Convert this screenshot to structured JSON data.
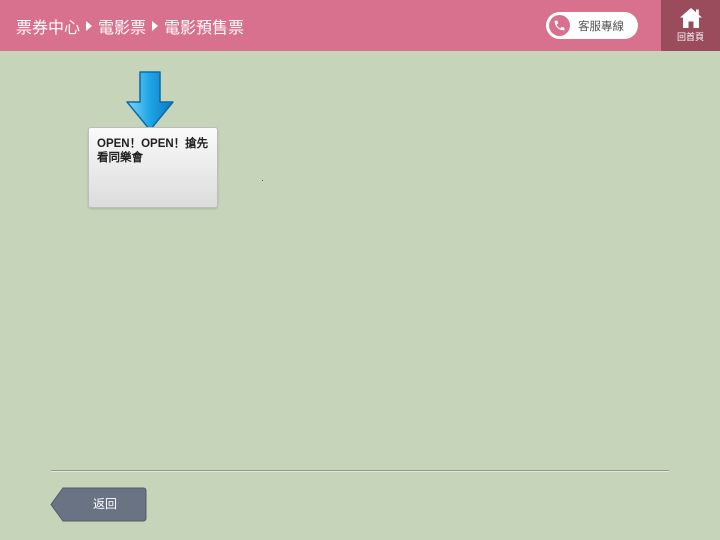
{
  "header": {
    "breadcrumb": [
      "票券中心",
      "電影票",
      "電影預售票"
    ],
    "service_label": "客服專線",
    "home_label": "回首頁"
  },
  "icons": {
    "phone": "phone-icon",
    "home": "home-icon",
    "pointer": "down-arrow-icon"
  },
  "cards": [
    {
      "title": "OPEN！OPEN！搶先看同樂會"
    }
  ],
  "footer": {
    "back_label": "返回"
  },
  "colors": {
    "header": "#d8718d",
    "home": "#9a4c5c",
    "background": "#c6d5b9",
    "arrow": "#1ea5e6",
    "back_button": "#6a7384"
  }
}
